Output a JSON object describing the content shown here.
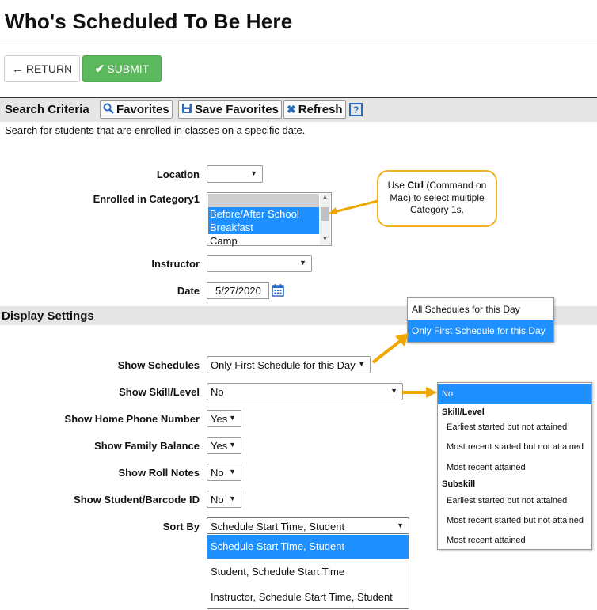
{
  "page": {
    "title": "Who's Scheduled To Be Here"
  },
  "actions": {
    "return_label": "RETURN",
    "submit_label": "SUBMIT"
  },
  "search": {
    "section_title": "Search Criteria",
    "favorites_label": "Favorites",
    "save_favorites_label": "Save Favorites",
    "refresh_label": "Refresh",
    "help_label": "?",
    "description": "Search for students that are enrolled in classes on a specific date."
  },
  "fields": {
    "location": {
      "label": "Location",
      "value": ""
    },
    "category1": {
      "label": "Enrolled in Category1",
      "options": [
        "",
        "Before/After School",
        "Breakfast",
        "Camp"
      ]
    },
    "instructor": {
      "label": "Instructor",
      "value": ""
    },
    "date": {
      "label": "Date",
      "value": "5/27/2020"
    }
  },
  "callout": {
    "prefix": "Use ",
    "bold": "Ctrl",
    "rest": " (Command on Mac) to select multiple Category 1s."
  },
  "display": {
    "section_title": "Display Settings",
    "show_schedules": {
      "label": "Show Schedules",
      "value": "Only First Schedule for this Day"
    },
    "show_skill_level": {
      "label": "Show Skill/Level",
      "value": "No"
    },
    "show_home_phone": {
      "label": "Show Home Phone Number",
      "value": "Yes"
    },
    "show_family_balance": {
      "label": "Show Family Balance",
      "value": "Yes"
    },
    "show_roll_notes": {
      "label": "Show Roll Notes",
      "value": "No"
    },
    "show_student_barcode": {
      "label": "Show Student/Barcode ID",
      "value": "No"
    },
    "sort_by": {
      "label": "Sort By",
      "value": "Schedule Start Time, Student"
    }
  },
  "schedules_dropdown": {
    "options": [
      "All Schedules for this Day",
      "Only First Schedule for this Day"
    ]
  },
  "skill_dropdown": {
    "selected": "No",
    "group1": "Skill/Level",
    "group1_options": [
      "Earliest started but not attained",
      "Most recent started but not attained",
      "Most recent attained"
    ],
    "group2": "Subskill",
    "group2_options": [
      "Earliest started but not attained",
      "Most recent started but not attained",
      "Most recent attained"
    ]
  },
  "sort_dropdown": {
    "options": [
      "Schedule Start Time, Student",
      "Student, Schedule Start Time",
      "Instructor, Schedule Start Time, Student"
    ]
  },
  "colors": {
    "submit": "#5cb85c",
    "highlight": "#1e90ff",
    "callout_border": "#f0b020",
    "annotation_arrow": "#f0a800"
  },
  "icons": [
    "arrow-left-icon",
    "check-icon",
    "search-icon",
    "save-icon",
    "refresh-x-icon",
    "help-icon",
    "calendar-icon",
    "dropdown-arrow-icon"
  ]
}
